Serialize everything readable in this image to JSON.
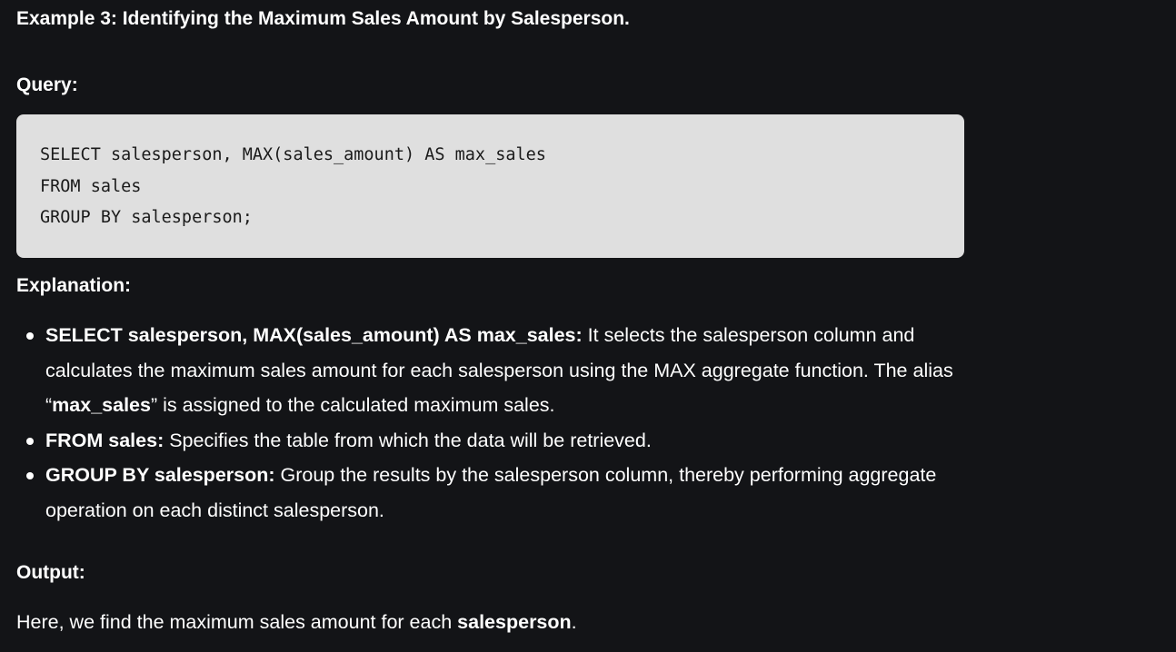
{
  "heading": "Example 3: Identifying the Maximum Sales Amount by Salesperson.",
  "query_label": "Query:",
  "code": [
    "SELECT salesperson, MAX(sales_amount) AS max_sales",
    "FROM sales",
    "GROUP BY salesperson;"
  ],
  "explanation_label": "Explanation:",
  "bullets": [
    {
      "term": "SELECT salesperson, MAX(sales_amount) AS max_sales:",
      "text_before": " It selects the salesperson column and calculates the maximum sales amount for each salesperson using the MAX aggregate function. The alias “",
      "bold_mid": "max_sales",
      "text_after": "” is assigned to the calculated maximum sales."
    },
    {
      "term": "FROM sales:",
      "text": " Specifies the table from which the data will be retrieved."
    },
    {
      "term": "GROUP BY salesperson:",
      "text": " Group the results by the salesperson column, thereby performing aggregate operation on each distinct salesperson."
    }
  ],
  "output_label": "Output:",
  "output_text_before": "Here, we find the maximum sales amount for each ",
  "output_bold": "salesperson",
  "output_text_after": "."
}
